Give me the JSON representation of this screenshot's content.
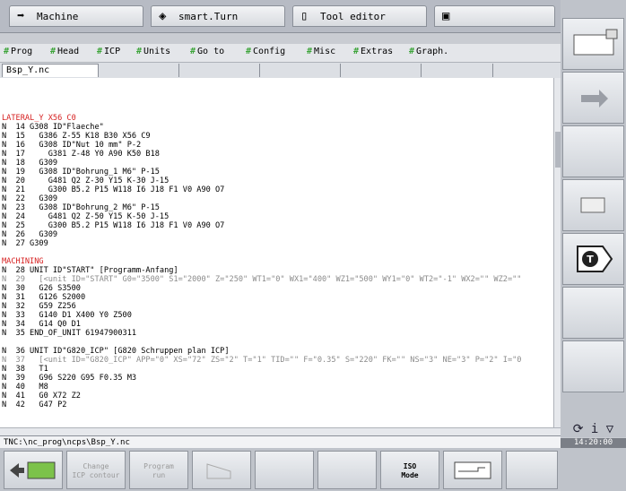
{
  "tabs": [
    {
      "label": "Machine",
      "icon": "arrow-right-icon"
    },
    {
      "label": "smart.Turn",
      "icon": "diamond-arrows-icon"
    },
    {
      "label": "Tool editor",
      "icon": "tool-editor-icon"
    },
    {
      "label": "",
      "icon": "save-icon"
    }
  ],
  "menu": [
    "Prog",
    "Head",
    "ICP",
    "Units",
    "Go to",
    "Config",
    "Misc",
    "Extras",
    "Graph."
  ],
  "file_tab": "Bsp_Y.nc",
  "code_lines": [
    {
      "t": "LATERAL_Y X56 C0",
      "c": "red"
    },
    {
      "t": "N  14 G308 ID\"Flaeche\""
    },
    {
      "t": "N  15   G386 Z-55 K18 B30 X56 C9"
    },
    {
      "t": "N  16   G308 ID\"Nut 10 mm\" P-2"
    },
    {
      "t": "N  17     G381 Z-48 Y0 A90 K50 B18"
    },
    {
      "t": "N  18   G309"
    },
    {
      "t": "N  19   G308 ID\"Bohrung_1 M6\" P-15"
    },
    {
      "t": "N  20     G481 Q2 Z-30 Y15 K-30 J-15"
    },
    {
      "t": "N  21     G300 B5.2 P15 W118 I6 J18 F1 V0 A90 O7"
    },
    {
      "t": "N  22   G309"
    },
    {
      "t": "N  23   G308 ID\"Bohrung_2 M6\" P-15"
    },
    {
      "t": "N  24     G481 Q2 Z-50 Y15 K-50 J-15"
    },
    {
      "t": "N  25     G300 B5.2 P15 W118 I6 J18 F1 V0 A90 O7"
    },
    {
      "t": "N  26   G309"
    },
    {
      "t": "N  27 G309"
    },
    {
      "t": ""
    },
    {
      "t": "MACHINING",
      "c": "red"
    },
    {
      "t": "N  28 UNIT ID\"START\" [Programm-Anfang]"
    },
    {
      "t": "N  29   [<unit ID=\"START\" G0=\"3500\" S1=\"2000\" Z=\"250\" WT1=\"0\" WX1=\"400\" WZ1=\"500\" WY1=\"0\" WT2=\"-1\" WX2=\"\" WZ2=\"\"",
      "c": "grey"
    },
    {
      "t": "N  30   G26 S3500"
    },
    {
      "t": "N  31   G126 S2000"
    },
    {
      "t": "N  32   G59 Z256"
    },
    {
      "t": "N  33   G140 D1 X400 Y0 Z500"
    },
    {
      "t": "N  34   G14 Q0 D1"
    },
    {
      "t": "N  35 END_OF_UNIT 61947900311"
    },
    {
      "t": ""
    },
    {
      "t": "N  36 UNIT ID\"G820_ICP\" [G820 Schruppen plan ICP]"
    },
    {
      "t": "N  37   [<unit ID=\"G820_ICP\" APP=\"0\" XS=\"72\" ZS=\"2\" T=\"1\" TID=\"\" F=\"0.35\" S=\"220\" FK=\"\" NS=\"3\" NE=\"3\" P=\"2\" I=\"0",
      "c": "grey"
    },
    {
      "t": "N  38   T1"
    },
    {
      "t": "N  39   G96 S220 G95 F0.35 M3"
    },
    {
      "t": "N  40   M8"
    },
    {
      "t": "N  41   G0 X72 Z2"
    },
    {
      "t": "N  42   G47 P2"
    }
  ],
  "status_path": "TNC:\\nc_prog\\ncps\\Bsp_Y.nc",
  "softkeys_bottom": [
    {
      "label": "",
      "icon": "program-manager-icon"
    },
    {
      "label": "Change\nICP contour"
    },
    {
      "label": "Program\nrun"
    },
    {
      "label": "",
      "icon": "simulation-icon"
    },
    {
      "label": ""
    },
    {
      "label": ""
    },
    {
      "label": "ISO\nMode",
      "active": true
    },
    {
      "label": "",
      "icon": "tool-table-icon"
    },
    {
      "label": ""
    }
  ],
  "clock": "14:20:00",
  "nav_glyphs": "⟳ i ▽"
}
